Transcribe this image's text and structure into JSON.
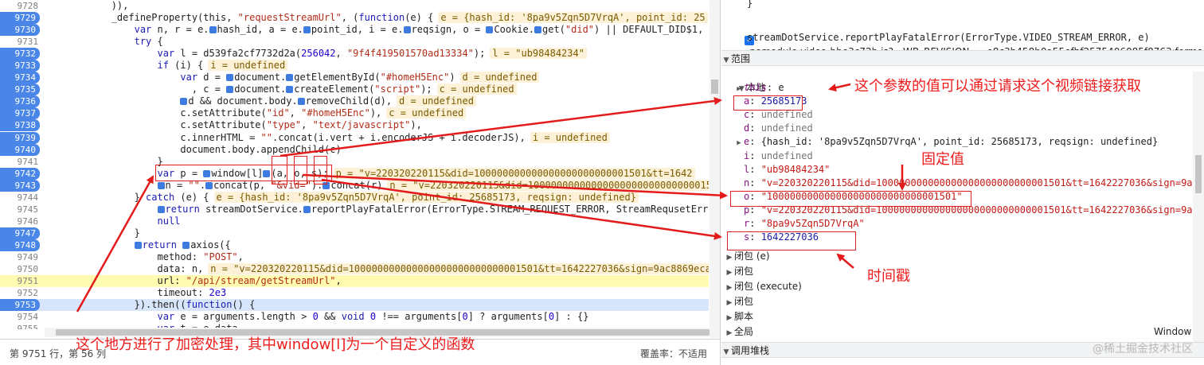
{
  "source": {
    "lines": [
      {
        "num": "9728",
        "bp": false,
        "hl": "",
        "indent": "            ",
        "parts": [
          {
            "t": ")),",
            "c": "p"
          }
        ],
        "inline": ""
      },
      {
        "num": "9729",
        "bp": true,
        "hl": "",
        "indent": "            ",
        "parts": [
          {
            "t": "_defineProperty(this, ",
            "c": "p"
          },
          {
            "t": "\"requestStreamUrl\"",
            "c": "s"
          },
          {
            "t": ", (",
            "c": "p"
          },
          {
            "t": "function",
            "c": "k"
          },
          {
            "t": "(e) {",
            "c": "p"
          }
        ],
        "inline": "e = {hash_id: '8pa9v5Zqn5D7VrqA', point_id: 25"
      },
      {
        "num": "9730",
        "bp": true,
        "hl": "",
        "indent": "                ",
        "parts": [
          {
            "t": "var",
            "c": "k"
          },
          {
            "t": " n, r = e.",
            "c": "p"
          },
          {
            "t": "M",
            "c": "mk"
          },
          {
            "t": "hash_id, a = e.",
            "c": "p"
          },
          {
            "t": "M",
            "c": "mk"
          },
          {
            "t": "point_id, i = e.",
            "c": "p"
          },
          {
            "t": "M",
            "c": "mk"
          },
          {
            "t": "reqsign, o = ",
            "c": "p"
          },
          {
            "t": "M",
            "c": "mk"
          },
          {
            "t": "Cookie.",
            "c": "p"
          },
          {
            "t": "M",
            "c": "mk"
          },
          {
            "t": "get(",
            "c": "p"
          },
          {
            "t": "\"did\"",
            "c": "s"
          },
          {
            "t": ") || DEFAULT_DID$1,",
            "c": "p"
          }
        ],
        "inline": ""
      },
      {
        "num": "9731",
        "bp": false,
        "hl": "",
        "indent": "                ",
        "parts": [
          {
            "t": "try",
            "c": "k"
          },
          {
            "t": " {",
            "c": "p"
          }
        ],
        "inline": ""
      },
      {
        "num": "9732",
        "bp": true,
        "hl": "",
        "indent": "                    ",
        "parts": [
          {
            "t": "var",
            "c": "k"
          },
          {
            "t": " l = d539fa2cf7732d2a(",
            "c": "p"
          },
          {
            "t": "256042",
            "c": "n"
          },
          {
            "t": ", ",
            "c": "p"
          },
          {
            "t": "\"9f4f419501570ad13334\"",
            "c": "s"
          },
          {
            "t": ");",
            "c": "p"
          }
        ],
        "inline": "l = \"ub98484234\""
      },
      {
        "num": "9733",
        "bp": true,
        "hl": "",
        "indent": "                    ",
        "parts": [
          {
            "t": "if",
            "c": "k"
          },
          {
            "t": " (i) {",
            "c": "p"
          }
        ],
        "inline": "i = undefined"
      },
      {
        "num": "9734",
        "bp": true,
        "hl": "",
        "indent": "                        ",
        "parts": [
          {
            "t": "var",
            "c": "k"
          },
          {
            "t": " d = ",
            "c": "p"
          },
          {
            "t": "M",
            "c": "mk"
          },
          {
            "t": "document.",
            "c": "p"
          },
          {
            "t": "M",
            "c": "mk"
          },
          {
            "t": "getElementById(",
            "c": "p"
          },
          {
            "t": "\"#homeH5Enc\"",
            "c": "s"
          },
          {
            "t": ")",
            "c": "p"
          }
        ],
        "inline": "d = undefined"
      },
      {
        "num": "9735",
        "bp": true,
        "hl": "",
        "indent": "                          ",
        "parts": [
          {
            "t": ", c = ",
            "c": "p"
          },
          {
            "t": "M",
            "c": "mk"
          },
          {
            "t": "document.",
            "c": "p"
          },
          {
            "t": "M",
            "c": "mk"
          },
          {
            "t": "createElement(",
            "c": "p"
          },
          {
            "t": "\"script\"",
            "c": "s"
          },
          {
            "t": ");",
            "c": "p"
          }
        ],
        "inline": "c = undefined"
      },
      {
        "num": "9736",
        "bp": true,
        "hl": "",
        "indent": "                        ",
        "parts": [
          {
            "t": "M",
            "c": "mk"
          },
          {
            "t": "d && document.body.",
            "c": "p"
          },
          {
            "t": "M",
            "c": "mk"
          },
          {
            "t": "removeChild(d),",
            "c": "p"
          }
        ],
        "inline": "d = undefined"
      },
      {
        "num": "9737",
        "bp": true,
        "hl": "",
        "indent": "                        ",
        "parts": [
          {
            "t": "c.setAttribute(",
            "c": "p"
          },
          {
            "t": "\"id\"",
            "c": "s"
          },
          {
            "t": ", ",
            "c": "p"
          },
          {
            "t": "\"#homeH5Enc\"",
            "c": "s"
          },
          {
            "t": "),",
            "c": "p"
          }
        ],
        "inline": "c = undefined"
      },
      {
        "num": "9738",
        "bp": true,
        "hl": "",
        "indent": "                        ",
        "parts": [
          {
            "t": "c.setAttribute(",
            "c": "p"
          },
          {
            "t": "\"type\"",
            "c": "s"
          },
          {
            "t": ", ",
            "c": "p"
          },
          {
            "t": "\"text/javascript\"",
            "c": "s"
          },
          {
            "t": "),",
            "c": "p"
          }
        ],
        "inline": ""
      },
      {
        "num": "9739",
        "bp": true,
        "hl": "",
        "indent": "                        ",
        "parts": [
          {
            "t": "c.innerHTML = ",
            "c": "p"
          },
          {
            "t": "\"\"",
            "c": "s"
          },
          {
            "t": ".concat(i.vert + i.encoderJS + i.decoderJS),",
            "c": "p"
          }
        ],
        "inline": "i = undefined"
      },
      {
        "num": "9740",
        "bp": true,
        "hl": "",
        "indent": "                        ",
        "parts": [
          {
            "t": "document.body.appendChild(c)",
            "c": "p"
          }
        ],
        "inline": ""
      },
      {
        "num": "9741",
        "bp": false,
        "hl": "",
        "indent": "                    ",
        "parts": [
          {
            "t": "}",
            "c": "p"
          }
        ],
        "inline": ""
      },
      {
        "num": "9742",
        "bp": true,
        "hl": "",
        "indent": "                    ",
        "parts": [
          {
            "t": "var",
            "c": "k"
          },
          {
            "t": " p = ",
            "c": "p"
          },
          {
            "t": "M",
            "c": "mk"
          },
          {
            "t": "window[l]",
            "c": "p"
          },
          {
            "t": "M",
            "c": "mk"
          },
          {
            "t": "(a, o, s);",
            "c": "p"
          }
        ],
        "inline": "p = \"v=220320220115&did=100000000000000000000000001501&tt=1642"
      },
      {
        "num": "9743",
        "bp": true,
        "hl": "",
        "indent": "                    ",
        "parts": [
          {
            "t": "M",
            "c": "mk"
          },
          {
            "t": "n = ",
            "c": "p"
          },
          {
            "t": "\"\"",
            "c": "s"
          },
          {
            "t": ".",
            "c": "p"
          },
          {
            "t": "M",
            "c": "mk"
          },
          {
            "t": "concat(p, ",
            "c": "p"
          },
          {
            "t": "\"&vid=\"",
            "c": "s"
          },
          {
            "t": ").",
            "c": "p"
          },
          {
            "t": "M",
            "c": "mk"
          },
          {
            "t": "concat(r)",
            "c": "p"
          }
        ],
        "inline": "n = \"v=220320220115&did=100000000000000000000000000000150"
      },
      {
        "num": "9744",
        "bp": false,
        "hl": "",
        "indent": "                ",
        "parts": [
          {
            "t": "} ",
            "c": "p"
          },
          {
            "t": "catch",
            "c": "k"
          },
          {
            "t": " (e) {",
            "c": "p"
          }
        ],
        "inline": "e = {hash_id: '8pa9v5Zqn5D7VrqA', point_id: 25685173, reqsign: undefined}"
      },
      {
        "num": "9745",
        "bp": false,
        "hl": "",
        "indent": "                    ",
        "parts": [
          {
            "t": "M",
            "c": "mk"
          },
          {
            "t": "return",
            "c": "k"
          },
          {
            "t": " streamDotService.",
            "c": "p"
          },
          {
            "t": "M",
            "c": "mk"
          },
          {
            "t": "reportPlayFatalError(ErrorType.STREAM_REQUEST_ERROR, StreamRequsetErro",
            "c": "p"
          }
        ],
        "inline": ""
      },
      {
        "num": "9746",
        "bp": false,
        "hl": "",
        "indent": "                    ",
        "parts": [
          {
            "t": "null",
            "c": "k"
          }
        ],
        "inline": ""
      },
      {
        "num": "9747",
        "bp": true,
        "hl": "",
        "indent": "                ",
        "parts": [
          {
            "t": "}",
            "c": "p"
          }
        ],
        "inline": ""
      },
      {
        "num": "9748",
        "bp": true,
        "hl": "",
        "indent": "                ",
        "parts": [
          {
            "t": "M",
            "c": "mk"
          },
          {
            "t": "return",
            "c": "k"
          },
          {
            "t": " ",
            "c": "p"
          },
          {
            "t": "M",
            "c": "mk"
          },
          {
            "t": "axios({",
            "c": "p"
          }
        ],
        "inline": ""
      },
      {
        "num": "9749",
        "bp": false,
        "hl": "",
        "indent": "                    ",
        "parts": [
          {
            "t": "method: ",
            "c": "p"
          },
          {
            "t": "\"POST\"",
            "c": "s"
          },
          {
            "t": ",",
            "c": "p"
          }
        ],
        "inline": ""
      },
      {
        "num": "9750",
        "bp": false,
        "hl": "",
        "indent": "                    ",
        "parts": [
          {
            "t": "data: n,",
            "c": "p"
          }
        ],
        "inline": "n = \"v=220320220115&did=100000000000000000000000000001501&tt=1642227036&sign=9ac8869eca"
      },
      {
        "num": "9751",
        "bp": false,
        "hl": "hl-yellow",
        "indent": "                    ",
        "parts": [
          {
            "t": "url: ",
            "c": "p"
          },
          {
            "t": "\"/api/stream/getStreamUrl\"",
            "c": "s"
          },
          {
            "t": ",",
            "c": "p"
          }
        ],
        "inline": ""
      },
      {
        "num": "9752",
        "bp": false,
        "hl": "",
        "indent": "                    ",
        "parts": [
          {
            "t": "timeout: ",
            "c": "p"
          },
          {
            "t": "2e3",
            "c": "n"
          }
        ],
        "inline": ""
      },
      {
        "num": "9753",
        "bp": true,
        "hl": "hl-blue",
        "indent": "                ",
        "parts": [
          {
            "t": "}).then((",
            "c": "p"
          },
          {
            "t": "function",
            "c": "k"
          },
          {
            "t": "() {",
            "c": "p"
          }
        ],
        "inline": ""
      },
      {
        "num": "9754",
        "bp": false,
        "hl": "",
        "indent": "                    ",
        "parts": [
          {
            "t": "var",
            "c": "k"
          },
          {
            "t": " e = arguments.length > ",
            "c": "p"
          },
          {
            "t": "0",
            "c": "n"
          },
          {
            "t": " && ",
            "c": "p"
          },
          {
            "t": "void",
            "c": "k"
          },
          {
            "t": " ",
            "c": "p"
          },
          {
            "t": "0",
            "c": "n"
          },
          {
            "t": " !== arguments[",
            "c": "p"
          },
          {
            "t": "0",
            "c": "n"
          },
          {
            "t": "] ? arguments[",
            "c": "p"
          },
          {
            "t": "0",
            "c": "n"
          },
          {
            "t": "] : {}",
            "c": "p"
          }
        ],
        "inline": ""
      },
      {
        "num": "9755",
        "bp": false,
        "hl": "",
        "indent": "                    ",
        "parts": [
          {
            "t": "var",
            "c": "k"
          },
          {
            "t": " t = e.data",
            "c": "p"
          }
        ],
        "inline": ""
      }
    ],
    "status_position": "第 9751 行，第 56 列",
    "status_coverage": "覆盖率：不适用"
  },
  "scope": {
    "top_brace": "}",
    "breakpoint_file": "nomodule-video-bbe3c72b.js?__WB_REVISION__=e8c3b458b0a55efbf2575406085f8763:forma...",
    "breakpoint_code": "streamDotService.reportPlayFatalError(ErrorType.VIDEO_STREAM_ERROR, e)",
    "section_scope": "范围",
    "local_label": "本地",
    "vars": [
      {
        "name": "this",
        "value": "e",
        "kind": "plain",
        "expand": true
      },
      {
        "name": "a",
        "value": "25685173",
        "kind": "num",
        "expand": false
      },
      {
        "name": "c",
        "value": "undefined",
        "kind": "undef",
        "expand": false
      },
      {
        "name": "d",
        "value": "undefined",
        "kind": "undef",
        "expand": false
      },
      {
        "name": "e",
        "value": "{hash_id: '8pa9v5Zqn5D7VrqA', point_id: 25685173, reqsign: undefined}",
        "kind": "plain",
        "expand": true
      },
      {
        "name": "i",
        "value": "undefined",
        "kind": "undef",
        "expand": false
      },
      {
        "name": "l",
        "value": "\"ub98484234\"",
        "kind": "str",
        "expand": false
      },
      {
        "name": "n",
        "value": "\"v=220320220115&did=100000000000000000000000000001501&tt=1642227036&sign=9a...",
        "kind": "str",
        "expand": false
      },
      {
        "name": "o",
        "value": "\"100000000000000000000000000001501\"",
        "kind": "str",
        "expand": false
      },
      {
        "name": "p",
        "value": "\"v=220320220115&did=100000000000000000000000000001501&tt=1642227036&sign=9a...",
        "kind": "str",
        "expand": false
      },
      {
        "name": "r",
        "value": "\"8pa9v5Zqn5D7VrqA\"",
        "kind": "str",
        "expand": false
      },
      {
        "name": "s",
        "value": "1642227036",
        "kind": "num",
        "expand": false
      }
    ],
    "closures": [
      "闭包 (e)",
      "闭包",
      "闭包 (execute)",
      "闭包",
      "脚本",
      "全局"
    ],
    "global_value": "Window",
    "section_callstack": "调用堆栈"
  },
  "annotations": {
    "param_note": "这个参数的值可以通过请求这个视频链接获取",
    "fixed_value": "固定值",
    "timestamp": "时间戳",
    "encrypt_note": "这个地方进行了加密处理，其中window[l]为一个自定义的函数"
  },
  "watermark": "@稀土掘金技术社区",
  "colors": {
    "annotation": "#ee1c1c",
    "breakpoint": "#4a86e8",
    "current_line": "#fffbb0"
  }
}
